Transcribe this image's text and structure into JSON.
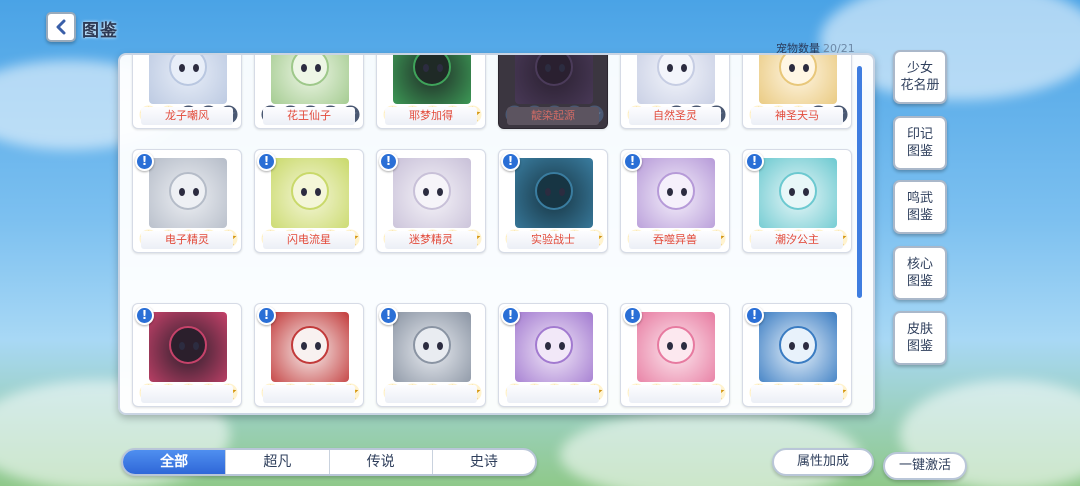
{
  "header": {
    "title": "图鉴",
    "count_label": "宠物数量",
    "count_value": "20/21"
  },
  "colors": {
    "accent": "#2f67d8",
    "name_text": "#e24a3a",
    "star_on": "#f7c02a",
    "star_off": "#6f7f9a"
  },
  "pets": [
    {
      "name": "龙子嘲风",
      "stars": 2,
      "alert": false,
      "locked": false,
      "icon": "dragon-art"
    },
    {
      "name": "花王仙子",
      "stars": 0,
      "alert": false,
      "locked": false,
      "icon": "flower-fairy-art"
    },
    {
      "name": "耶梦加得",
      "stars": 5,
      "alert": false,
      "locked": false,
      "icon": "serpent-art"
    },
    {
      "name": "靛染起源",
      "stars": 0,
      "alert": false,
      "locked": true,
      "icon": "shadow-art"
    },
    {
      "name": "自然圣灵",
      "stars": 2,
      "alert": false,
      "locked": false,
      "icon": "nature-spirit-art"
    },
    {
      "name": "神圣天马",
      "stars": 3,
      "alert": false,
      "locked": false,
      "icon": "pegasus-art"
    },
    {
      "name": "电子精灵",
      "stars": 5,
      "alert": true,
      "locked": false,
      "icon": "robot-headphones-art"
    },
    {
      "name": "闪电流星",
      "stars": 5,
      "alert": true,
      "locked": false,
      "icon": "lightning-cat-art"
    },
    {
      "name": "迷梦精灵",
      "stars": 5,
      "alert": true,
      "locked": false,
      "icon": "dream-creature-art"
    },
    {
      "name": "实验战士",
      "stars": 5,
      "alert": true,
      "locked": false,
      "icon": "dark-warrior-art"
    },
    {
      "name": "吞噬异兽",
      "stars": 5,
      "alert": true,
      "locked": false,
      "icon": "devourer-beast-art"
    },
    {
      "name": "潮汐公主",
      "stars": 5,
      "alert": true,
      "locked": false,
      "icon": "tide-princess-art"
    },
    {
      "name": "",
      "stars": 5,
      "alert": true,
      "locked": false,
      "icon": "dark-girl-art"
    },
    {
      "name": "",
      "stars": 5,
      "alert": true,
      "locked": false,
      "icon": "white-hair-girl-art"
    },
    {
      "name": "",
      "stars": 5,
      "alert": true,
      "locked": false,
      "icon": "mech-art"
    },
    {
      "name": "",
      "stars": 5,
      "alert": true,
      "locked": false,
      "icon": "purple-hair-girl-art"
    },
    {
      "name": "",
      "stars": 5,
      "alert": true,
      "locked": false,
      "icon": "pink-hair-girl-art"
    },
    {
      "name": "",
      "stars": 5,
      "alert": true,
      "locked": false,
      "icon": "peacock-art"
    }
  ],
  "side_buttons": [
    {
      "line1": "少女",
      "line2": "花名册"
    },
    {
      "line1": "印记",
      "line2": "图鉴"
    },
    {
      "line1": "鸣武",
      "line2": "图鉴"
    },
    {
      "line1": "核心",
      "line2": "图鉴"
    },
    {
      "line1": "皮肤",
      "line2": "图鉴"
    }
  ],
  "tabs": [
    "全部",
    "超凡",
    "传说",
    "史诗"
  ],
  "active_tab": 0,
  "buttons": {
    "attribute_bonus": "属性加成",
    "activate_all": "一键激活"
  }
}
